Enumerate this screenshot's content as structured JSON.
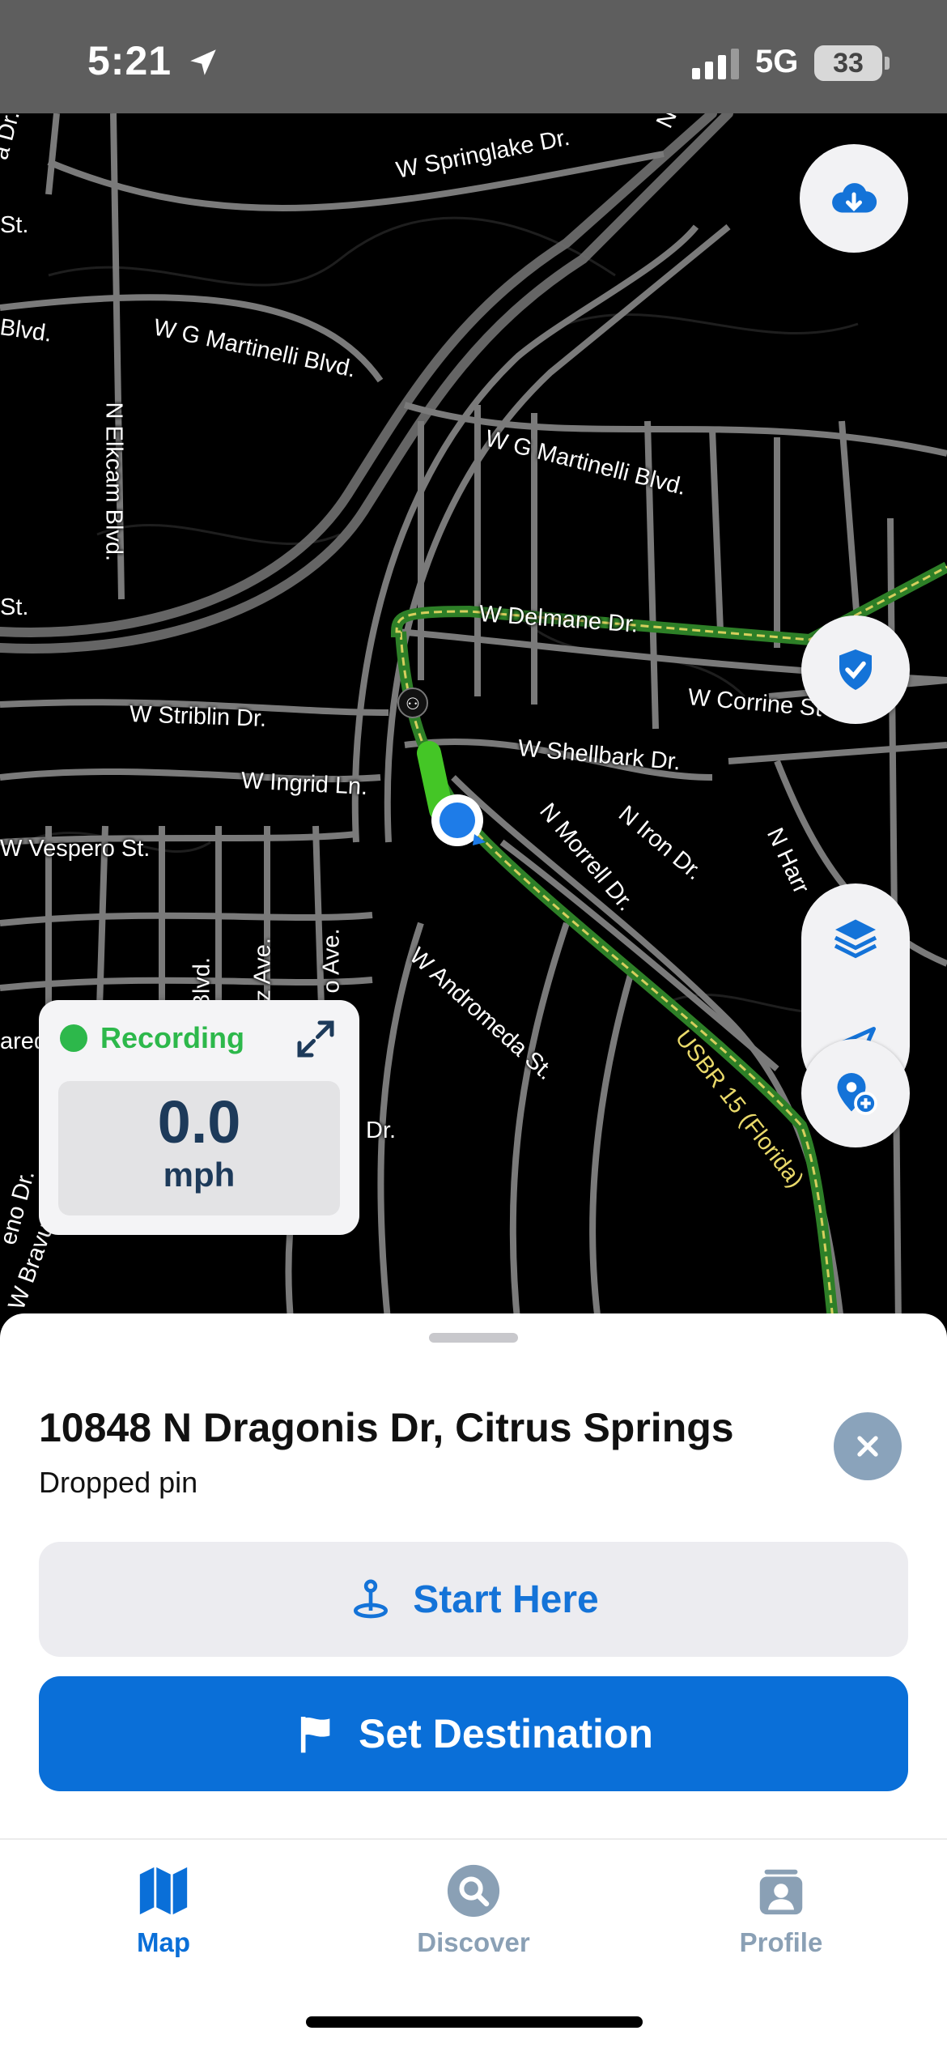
{
  "status_bar": {
    "time": "5:21",
    "network": "5G",
    "battery": "33"
  },
  "map": {
    "street_labels": [
      "W Springlake Dr.",
      "W G Martinelli Blvd.",
      "W G Martinelli Blvd.",
      "N Elkcam Blvd.",
      "W Delmane Dr.",
      "W Corrine St",
      "W Striblin Dr.",
      "W Shellbark Dr.",
      "W Ingrid Ln.",
      "N Morrell Dr.",
      "N Iron Dr.",
      "N Harr",
      "W Vespero St.",
      "W Andromeda St.",
      "Blvd.",
      "z Ave.",
      "o Ave.",
      "Dr.",
      "N La",
      "a Dr.",
      "St.",
      "Blvd.",
      "St.",
      "ared",
      "eno Dr.",
      "W Bravur"
    ],
    "route_label": "USBR 15 (Florida)",
    "controls": [
      "cloud-download-icon",
      "shield-check-icon",
      "layers-icon",
      "location-arrow-icon",
      "add-pin-icon"
    ]
  },
  "recording": {
    "label": "Recording",
    "speed": "0.0",
    "unit": "mph"
  },
  "sheet": {
    "title": "10848 N Dragonis Dr, Citrus Springs",
    "subtitle": "Dropped pin",
    "start_label": "Start Here",
    "destination_label": "Set Destination"
  },
  "tabs": [
    {
      "label": "Map",
      "active": true
    },
    {
      "label": "Discover",
      "active": false
    },
    {
      "label": "Profile",
      "active": false
    }
  ],
  "colors": {
    "accent": "#0a6fd8",
    "recording": "#2db84b",
    "route": "#3aa832",
    "tab_inactive": "#8aa0b5"
  }
}
